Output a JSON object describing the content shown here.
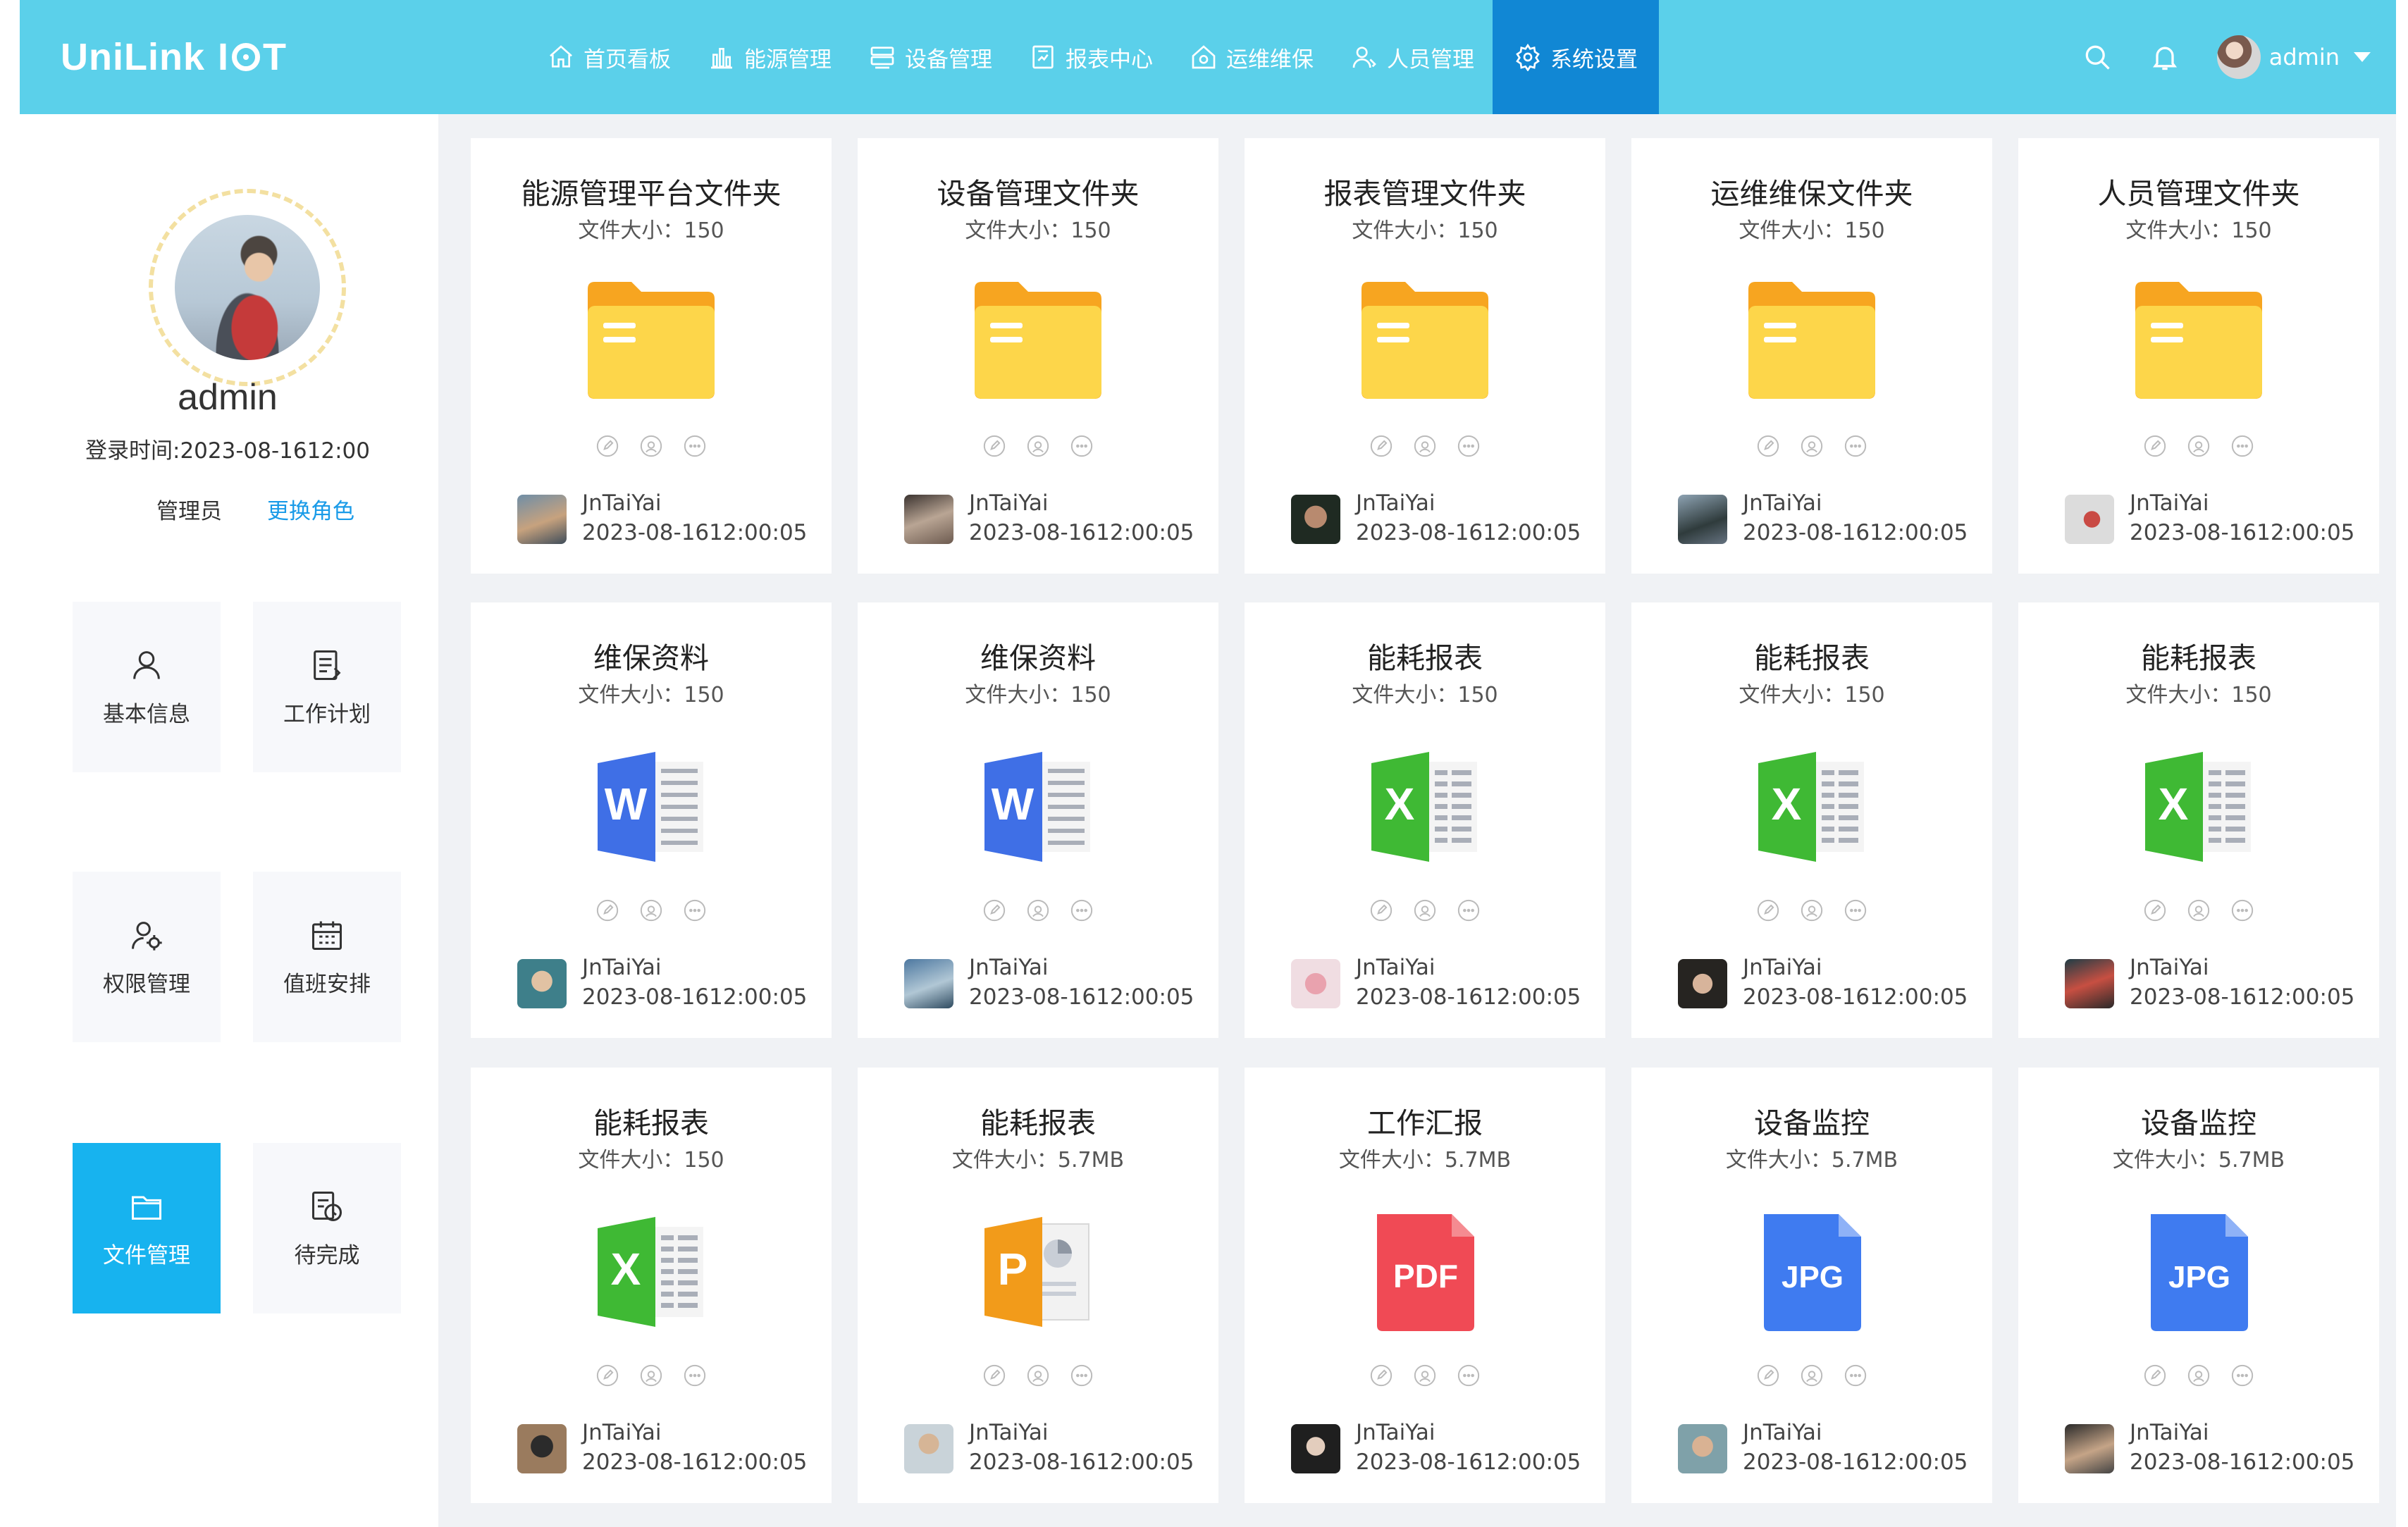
{
  "brand": {
    "logo_text": "UniLink",
    "logo_suffix_a": "I",
    "logo_suffix_b": "T"
  },
  "nav": [
    {
      "label": "首页看板",
      "icon": "home-icon"
    },
    {
      "label": "能源管理",
      "icon": "bar-chart-icon"
    },
    {
      "label": "设备管理",
      "icon": "device-icon"
    },
    {
      "label": "报表中心",
      "icon": "report-icon"
    },
    {
      "label": "运维维保",
      "icon": "maintenance-icon"
    },
    {
      "label": "人员管理",
      "icon": "people-icon"
    },
    {
      "label": "系统设置",
      "icon": "gear-icon",
      "active": true
    }
  ],
  "header": {
    "user_name": "admin"
  },
  "profile": {
    "name": "admin",
    "login_time": "登录时间:2023-08-1612:00",
    "role": "管理员",
    "switch_role": "更换角色"
  },
  "sidebar_tiles": [
    {
      "label": "基本信息",
      "icon": "user-icon"
    },
    {
      "label": "工作计划",
      "icon": "plan-icon"
    },
    {
      "label": "权限管理",
      "icon": "permission-icon"
    },
    {
      "label": "值班安排",
      "icon": "calendar-icon"
    },
    {
      "label": "文件管理",
      "icon": "folder-icon",
      "active": true
    },
    {
      "label": "待完成",
      "icon": "todo-icon"
    }
  ],
  "colors": {
    "header_bg": "#5bd0ea",
    "nav_active": "#1187d4",
    "tile_active": "#17b3ef",
    "link": "#1a9be8"
  },
  "files": [
    {
      "title": "能源管理平台文件夹",
      "size": "文件大小：150",
      "type": "folder",
      "user": "JnTaiYai",
      "date": "2023-08-1612:00:05"
    },
    {
      "title": "设备管理文件夹",
      "size": "文件大小：150",
      "type": "folder",
      "user": "JnTaiYai",
      "date": "2023-08-1612:00:05"
    },
    {
      "title": "报表管理文件夹",
      "size": "文件大小：150",
      "type": "folder",
      "user": "JnTaiYai",
      "date": "2023-08-1612:00:05"
    },
    {
      "title": "运维维保文件夹",
      "size": "文件大小：150",
      "type": "folder",
      "user": "JnTaiYai",
      "date": "2023-08-1612:00:05"
    },
    {
      "title": "人员管理文件夹",
      "size": "文件大小：150",
      "type": "folder",
      "user": "JnTaiYai",
      "date": "2023-08-1612:00:05"
    },
    {
      "title": "维保资料",
      "size": "文件大小：150",
      "type": "word",
      "user": "JnTaiYai",
      "date": "2023-08-1612:00:05"
    },
    {
      "title": "维保资料",
      "size": "文件大小：150",
      "type": "word",
      "user": "JnTaiYai",
      "date": "2023-08-1612:00:05"
    },
    {
      "title": "能耗报表",
      "size": "文件大小：150",
      "type": "excel",
      "user": "JnTaiYai",
      "date": "2023-08-1612:00:05"
    },
    {
      "title": "能耗报表",
      "size": "文件大小：150",
      "type": "excel",
      "user": "JnTaiYai",
      "date": "2023-08-1612:00:05"
    },
    {
      "title": "能耗报表",
      "size": "文件大小：150",
      "type": "excel",
      "user": "JnTaiYai",
      "date": "2023-08-1612:00:05"
    },
    {
      "title": "能耗报表",
      "size": "文件大小：150",
      "type": "excel",
      "user": "JnTaiYai",
      "date": "2023-08-1612:00:05"
    },
    {
      "title": "能耗报表",
      "size": "文件大小：5.7MB",
      "type": "ppt",
      "user": "JnTaiYai",
      "date": "2023-08-1612:00:05"
    },
    {
      "title": "工作汇报",
      "size": "文件大小：5.7MB",
      "type": "pdf",
      "user": "JnTaiYai",
      "date": "2023-08-1612:00:05"
    },
    {
      "title": "设备监控",
      "size": "文件大小：5.7MB",
      "type": "jpg",
      "user": "JnTaiYai",
      "date": "2023-08-1612:00:05"
    },
    {
      "title": "设备监控",
      "size": "文件大小：5.7MB",
      "type": "jpg",
      "user": "JnTaiYai",
      "date": "2023-08-1612:00:05"
    }
  ],
  "icon_text": {
    "word": "W",
    "excel": "X",
    "ppt": "P",
    "pdf": "PDF",
    "jpg": "JPG"
  }
}
